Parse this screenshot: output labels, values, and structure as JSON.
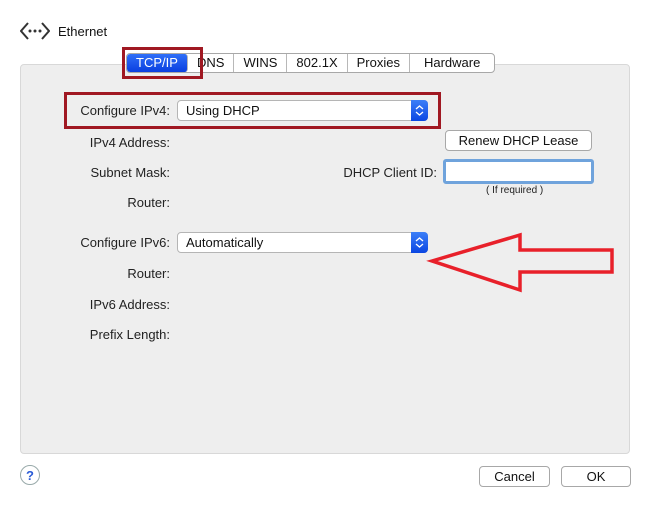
{
  "header": {
    "title": "Ethernet",
    "icon": "ethernet-icon"
  },
  "tabs": [
    {
      "label": "TCP/IP",
      "active": true
    },
    {
      "label": "DNS",
      "active": false
    },
    {
      "label": "WINS",
      "active": false
    },
    {
      "label": "802.1X",
      "active": false
    },
    {
      "label": "Proxies",
      "active": false
    },
    {
      "label": "Hardware",
      "active": false
    }
  ],
  "ipv4": {
    "configure_label": "Configure IPv4:",
    "configure_value": "Using DHCP",
    "address_label": "IPv4 Address:",
    "subnet_label": "Subnet Mask:",
    "router_label": "Router:",
    "renew_button": "Renew DHCP Lease",
    "client_id_label": "DHCP Client ID:",
    "client_id_value": "",
    "client_id_note": "( If required )"
  },
  "ipv6": {
    "configure_label": "Configure IPv6:",
    "configure_value": "Automatically",
    "router_label": "Router:",
    "address_label": "IPv6 Address:",
    "prefix_label": "Prefix Length:"
  },
  "footer": {
    "help_label": "?",
    "cancel_button": "Cancel",
    "ok_button": "OK"
  },
  "annotations": {
    "highlight_color": "#a01822",
    "arrow_color": "#e8202a"
  }
}
